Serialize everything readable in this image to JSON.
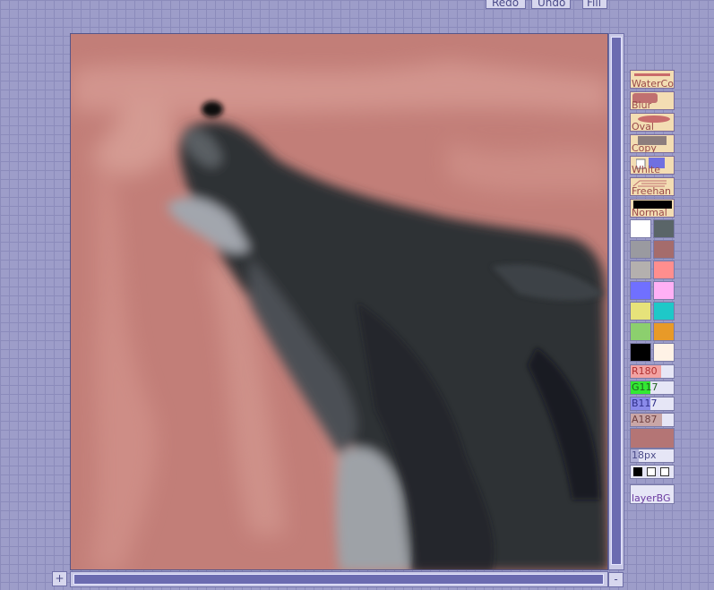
{
  "toolbar": {
    "redo_label": "Redo",
    "undo_label": "Undo",
    "fill_label": "Fill"
  },
  "tools": [
    {
      "label": "WaterCo",
      "icon": "watercolor-brush-icon"
    },
    {
      "label": "Blur",
      "icon": "blur-icon"
    },
    {
      "label": "Oval",
      "icon": "oval-icon"
    },
    {
      "label": "Copy",
      "icon": "copy-icon"
    },
    {
      "label": "White",
      "icon": "white-mask-icon"
    },
    {
      "label": "Freehan",
      "icon": "freehand-icon"
    },
    {
      "label": "Normal",
      "icon": "normal-blend-icon"
    }
  ],
  "palette": [
    "#ffffff",
    "#5a6568",
    "#9a9aa0",
    "#a56c6c",
    "#b4b0ae",
    "#ff8e8e",
    "#7070ff",
    "#ffb0f5",
    "#e6e27a",
    "#1ec8c8",
    "#8ccf6e",
    "#e89a28",
    "#000000",
    "#fff2e6"
  ],
  "sliders": {
    "r": {
      "text": "R180",
      "value": 180,
      "max": 255,
      "color": "#f2a2a2"
    },
    "g": {
      "text": "G117",
      "value": 117,
      "max": 255,
      "color": "#33e833"
    },
    "b": {
      "text": "B117",
      "value": 117,
      "max": 255,
      "color": "#8a8aea"
    },
    "a": {
      "text": "A187",
      "value": 187,
      "max": 255,
      "color": "#c9a6a6"
    },
    "size": {
      "text": "18px",
      "value": 18,
      "max": 100,
      "color": "#b0b0d8"
    }
  },
  "current_color": "#b47575",
  "zoom": {
    "in_label": "+",
    "out_label": "-"
  },
  "layer": {
    "label": "layerBG"
  }
}
